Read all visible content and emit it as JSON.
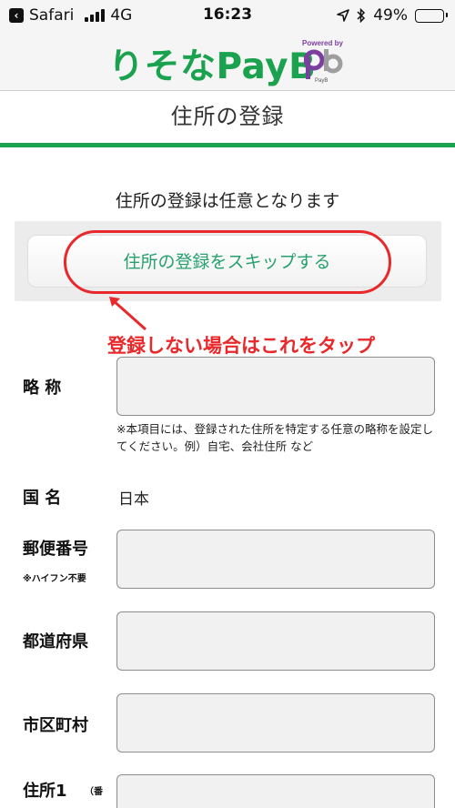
{
  "status_bar": {
    "back_app": "Safari",
    "network": "4G",
    "time": "16:23",
    "battery": "49%",
    "battery_level": 0.49
  },
  "brand": {
    "logo": "りそなPayB",
    "powered_by": "Powered by",
    "pb_caption": "PayB",
    "color": "#1aa24f"
  },
  "page": {
    "title": "住所の登録",
    "intro": "住所の登録は任意となります",
    "skip_button": "住所の登録をスキップする",
    "annotation": "登録しない場合はこれをタップ"
  },
  "form": {
    "nickname": {
      "label": "略 称",
      "note": "※本項目には、登録された住所を特定する任意の略称を設定してください。例）自宅、会社住所 など"
    },
    "country": {
      "label": "国 名",
      "value": "日本"
    },
    "postal": {
      "label": "郵便番号",
      "sub": "※ハイフン不要"
    },
    "prefecture": {
      "label": "都道府県"
    },
    "city": {
      "label": "市区町村"
    },
    "address1": {
      "label": "住所1",
      "sub": "（番"
    }
  },
  "colors": {
    "accent": "#1aa24f",
    "button_text": "#27a06f",
    "annotation": "#e8282a"
  }
}
